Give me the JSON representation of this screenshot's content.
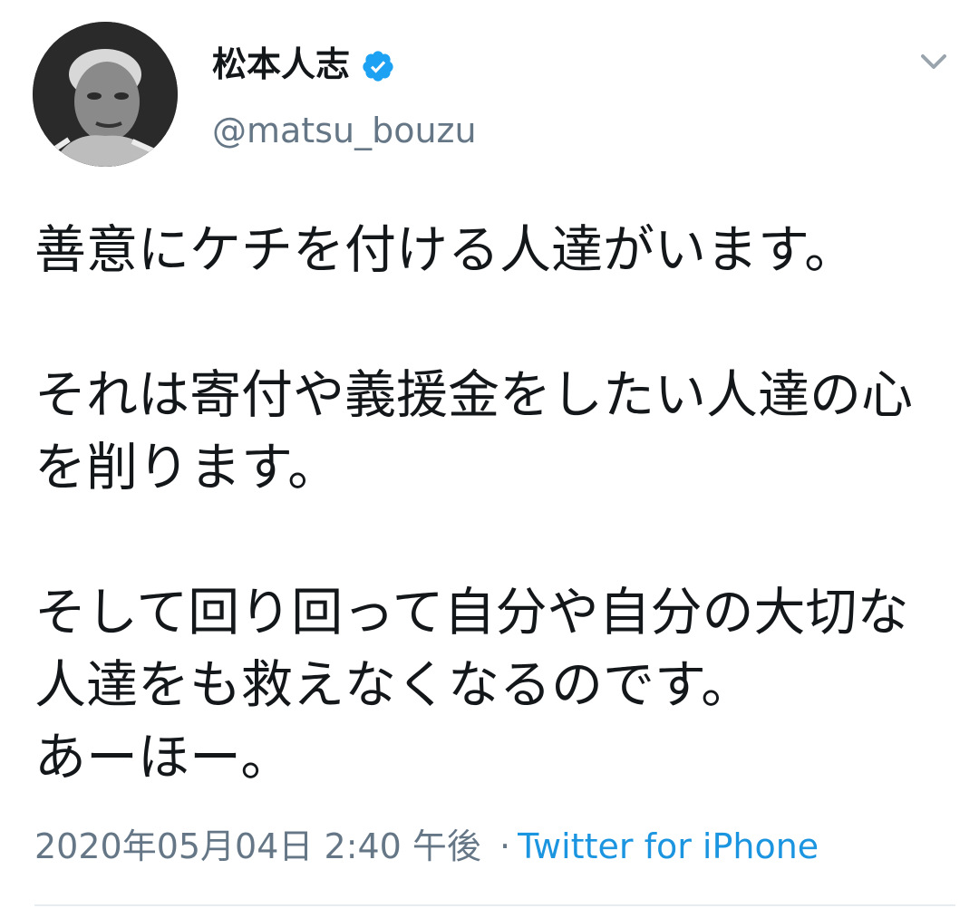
{
  "header": {
    "display_name": "松本人志",
    "handle": "@matsu_bouzu",
    "avatar_icon": "user-avatar",
    "verified_icon": "verified-badge-icon",
    "menu_icon": "chevron-down-icon",
    "verified_color": "#1da1f2"
  },
  "tweet": {
    "text": "善意にケチを付ける人達がいます。\n\nそれは寄付や義援金をしたい人達の心を削ります。\n\nそして回り回って自分や自分の大切な人達をも救えなくなるのです。\nあーほー。",
    "date": "2020年05月04日",
    "time": "2:40 午後",
    "separator": "·",
    "source": "Twitter for iPhone",
    "source_color": "#1b95e0"
  }
}
